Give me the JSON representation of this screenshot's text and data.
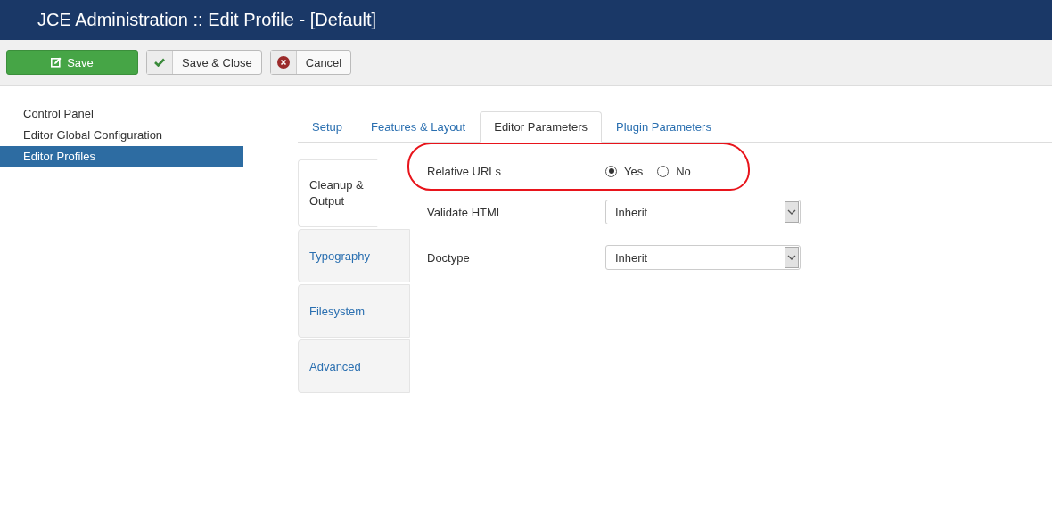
{
  "window": {
    "title": "JCE Administration :: Edit Profile - [Default]"
  },
  "toolbar": [
    {
      "label": "Save",
      "kind": "primary"
    },
    {
      "label": "Save & Close",
      "kind": "check"
    },
    {
      "label": "Cancel",
      "kind": "cancel"
    }
  ],
  "sidebar": {
    "items": [
      {
        "label": "Control Panel",
        "selected": false
      },
      {
        "label": "Editor Global Configuration",
        "selected": false
      },
      {
        "label": "Editor Profiles",
        "selected": true
      }
    ]
  },
  "tabs": [
    {
      "label": "Setup",
      "selected": false
    },
    {
      "label": "Features & Layout",
      "selected": false
    },
    {
      "label": "Editor Parameters",
      "selected": true
    },
    {
      "label": "Plugin Parameters",
      "selected": false
    }
  ],
  "side_tabs": [
    {
      "label": "Cleanup & Output",
      "selected": true
    },
    {
      "label": "Typography",
      "selected": false
    },
    {
      "label": "Filesystem",
      "selected": false
    },
    {
      "label": "Advanced",
      "selected": false
    }
  ],
  "fields": [
    {
      "label": "Relative URLs",
      "kind": "radio",
      "options": [
        {
          "label": "Yes",
          "selected": true
        },
        {
          "label": "No",
          "selected": false
        }
      ]
    },
    {
      "label": "Validate HTML",
      "kind": "select",
      "value": "Inherit"
    },
    {
      "label": "Doctype",
      "kind": "select",
      "value": "Inherit"
    }
  ]
}
